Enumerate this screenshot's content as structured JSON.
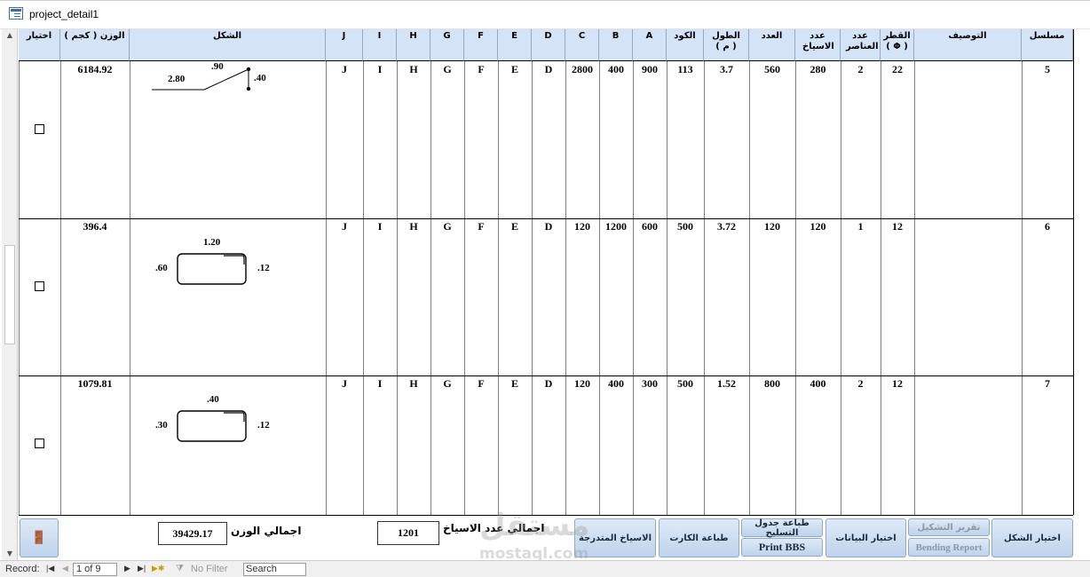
{
  "window": {
    "title": "project_detail1"
  },
  "headers": {
    "select": "اختيار",
    "weight": "الوزن ( كجم )",
    "shape": "الشكل",
    "j": "J",
    "i": "I",
    "h": "H",
    "g": "G",
    "f": "F",
    "e": "E",
    "d": "D",
    "c": "C",
    "b": "B",
    "a": "A",
    "code": "الكود",
    "length": "الطول ( م )",
    "count": "العدد",
    "bars": "عدد الاسياخ",
    "elements": "عدد العناصر",
    "diameter": "القطر ( Φ )",
    "description": "التوصيف",
    "serial": "مسلسل"
  },
  "rows": [
    {
      "serial": "5",
      "description": "",
      "diameter": "22",
      "elements": "2",
      "bars": "280",
      "count": "560",
      "length": "3.7",
      "code": "113",
      "a": "900",
      "b": "400",
      "c": "2800",
      "d": "D",
      "e": "E",
      "f": "F",
      "g": "G",
      "h": "H",
      "i": "I",
      "j": "J",
      "weight": "6184.92",
      "shape_labels": {
        "l1": ".90",
        "l2": "2.80",
        "l3": ".40"
      }
    },
    {
      "serial": "6",
      "description": "",
      "diameter": "12",
      "elements": "1",
      "bars": "120",
      "count": "120",
      "length": "3.72",
      "code": "500",
      "a": "600",
      "b": "1200",
      "c": "120",
      "d": "D",
      "e": "E",
      "f": "F",
      "g": "G",
      "h": "H",
      "i": "I",
      "j": "J",
      "weight": "396.4",
      "shape_labels": {
        "l1": "1.20",
        "l2": ".60",
        "l3": ".12"
      }
    },
    {
      "serial": "7",
      "description": "",
      "diameter": "12",
      "elements": "2",
      "bars": "400",
      "count": "800",
      "length": "1.52",
      "code": "500",
      "a": "300",
      "b": "400",
      "c": "120",
      "d": "D",
      "e": "E",
      "f": "F",
      "g": "G",
      "h": "H",
      "i": "I",
      "j": "J",
      "weight": "1079.81",
      "shape_labels": {
        "l1": ".40",
        "l2": ".30",
        "l3": ".12"
      }
    }
  ],
  "footer": {
    "select_shape_btn": "اختيار الشكل",
    "bending_report_ar": "تقرير التشكيل",
    "bending_report_en": "Bending Report",
    "select_data_btn": "اختيار البيانات",
    "print_schedule_ar": "طباعة جدول التسليح",
    "print_bbs": "Print BBS",
    "print_card_btn": "طباعة الكارت",
    "graded_bars_btn": "الاسياخ المتدرجة",
    "total_bars_label": "اجمالي عدد الاسياخ",
    "total_bars_value": "1201",
    "total_weight_label": "اجمالي الوزن",
    "total_weight_value": "39429.17"
  },
  "watermark": {
    "ar": "مستقل",
    "en": "mostaql.com"
  },
  "navbar": {
    "record_label": "Record:",
    "record_value": "1 of 9",
    "filter_label": "No Filter",
    "search_label": "Search"
  }
}
